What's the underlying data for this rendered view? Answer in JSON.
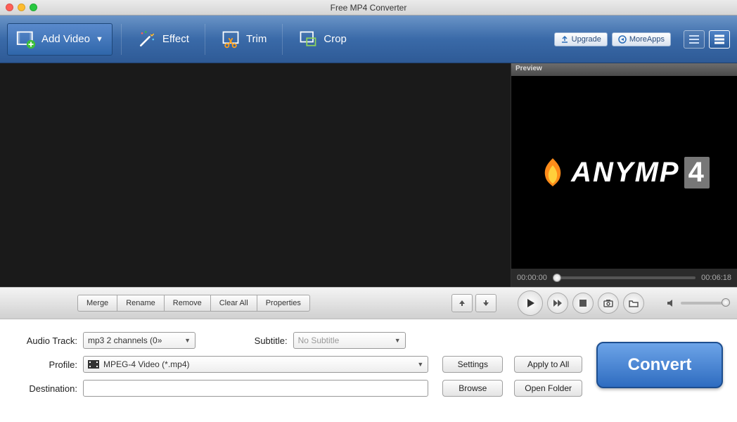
{
  "window": {
    "title": "Free MP4 Converter"
  },
  "toolbar": {
    "add_video": "Add Video",
    "effect": "Effect",
    "trim": "Trim",
    "crop": "Crop",
    "upgrade": "Upgrade",
    "more_apps": "MoreApps"
  },
  "preview": {
    "header": "Preview",
    "logo_text": "ANYMP",
    "logo_suffix": "4",
    "time_start": "00:00:00",
    "time_end": "00:06:18"
  },
  "listbar": {
    "merge": "Merge",
    "rename": "Rename",
    "remove": "Remove",
    "clear_all": "Clear All",
    "properties": "Properties"
  },
  "settings": {
    "audio_track_label": "Audio Track:",
    "audio_track_value": "mp3 2 channels (0»",
    "subtitle_label": "Subtitle:",
    "subtitle_value": "No Subtitle",
    "profile_label": "Profile:",
    "profile_value": "MPEG-4 Video (*.mp4)",
    "destination_label": "Destination:",
    "destination_value": "",
    "settings_btn": "Settings",
    "browse_btn": "Browse",
    "apply_all_btn": "Apply to All",
    "open_folder_btn": "Open Folder",
    "convert_btn": "Convert"
  }
}
